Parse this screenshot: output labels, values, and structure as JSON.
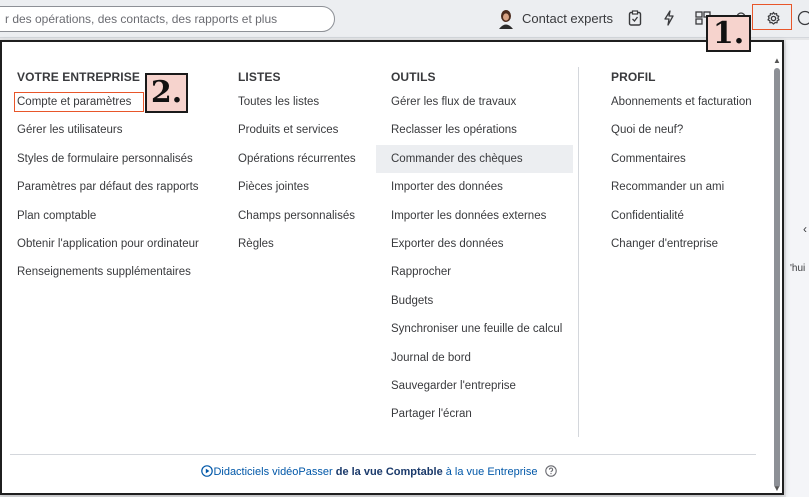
{
  "topbar": {
    "search_text": "r des opérations, des contacts, des rapports et plus",
    "contact_label": "Contact experts"
  },
  "markers": {
    "one": "1.",
    "two": "2."
  },
  "columns": [
    {
      "title": "VOTRE ENTREPRISE",
      "items": [
        "Compte et paramètres",
        "Gérer les utilisateurs",
        "Styles de formulaire personnalisés",
        "Paramètres par défaut des rapports",
        "Plan comptable",
        "Obtenir l'application pour ordinateur",
        "Renseignements supplémentaires"
      ]
    },
    {
      "title": "LISTES",
      "items": [
        "Toutes les listes",
        "Produits et services",
        "Opérations récurrentes",
        "Pièces jointes",
        "Champs personnalisés",
        "Règles"
      ]
    },
    {
      "title": "OUTILS",
      "items": [
        "Gérer les flux de travaux",
        "Reclasser les opérations",
        "Commander des chèques",
        "Importer des données",
        "Importer les données externes",
        "Exporter des données",
        "Rapprocher",
        "Budgets",
        "Synchroniser une feuille de calcul",
        "Journal de bord",
        "Sauvegarder l'entreprise",
        "Partager l'écran"
      ]
    },
    {
      "title": "PROFIL",
      "items": [
        "Abonnements et facturation",
        "Quoi de neuf?",
        "Commentaires",
        "Recommander un ami",
        "Confidentialité",
        "Changer d'entreprise"
      ]
    }
  ],
  "footer": {
    "video_link": "Didacticiels vidéo",
    "switch_prefix": "Passer ",
    "switch_bold": "de la vue Comptable",
    "switch_suffix": " à la vue Entreprise"
  },
  "background": {
    "peek_text": "'hui"
  },
  "icons": {
    "gear": "gear-icon",
    "help": "help-icon",
    "clipboard": "clipboard-icon",
    "bolt": "bolt-icon",
    "apps": "apps-icon",
    "bell": "bell-icon",
    "play": "play-circle-icon",
    "question": "question-circle-icon"
  },
  "colors": {
    "highlight_border": "#e8562a",
    "marker_fill": "#f6d3cd",
    "link": "#0057a8"
  }
}
